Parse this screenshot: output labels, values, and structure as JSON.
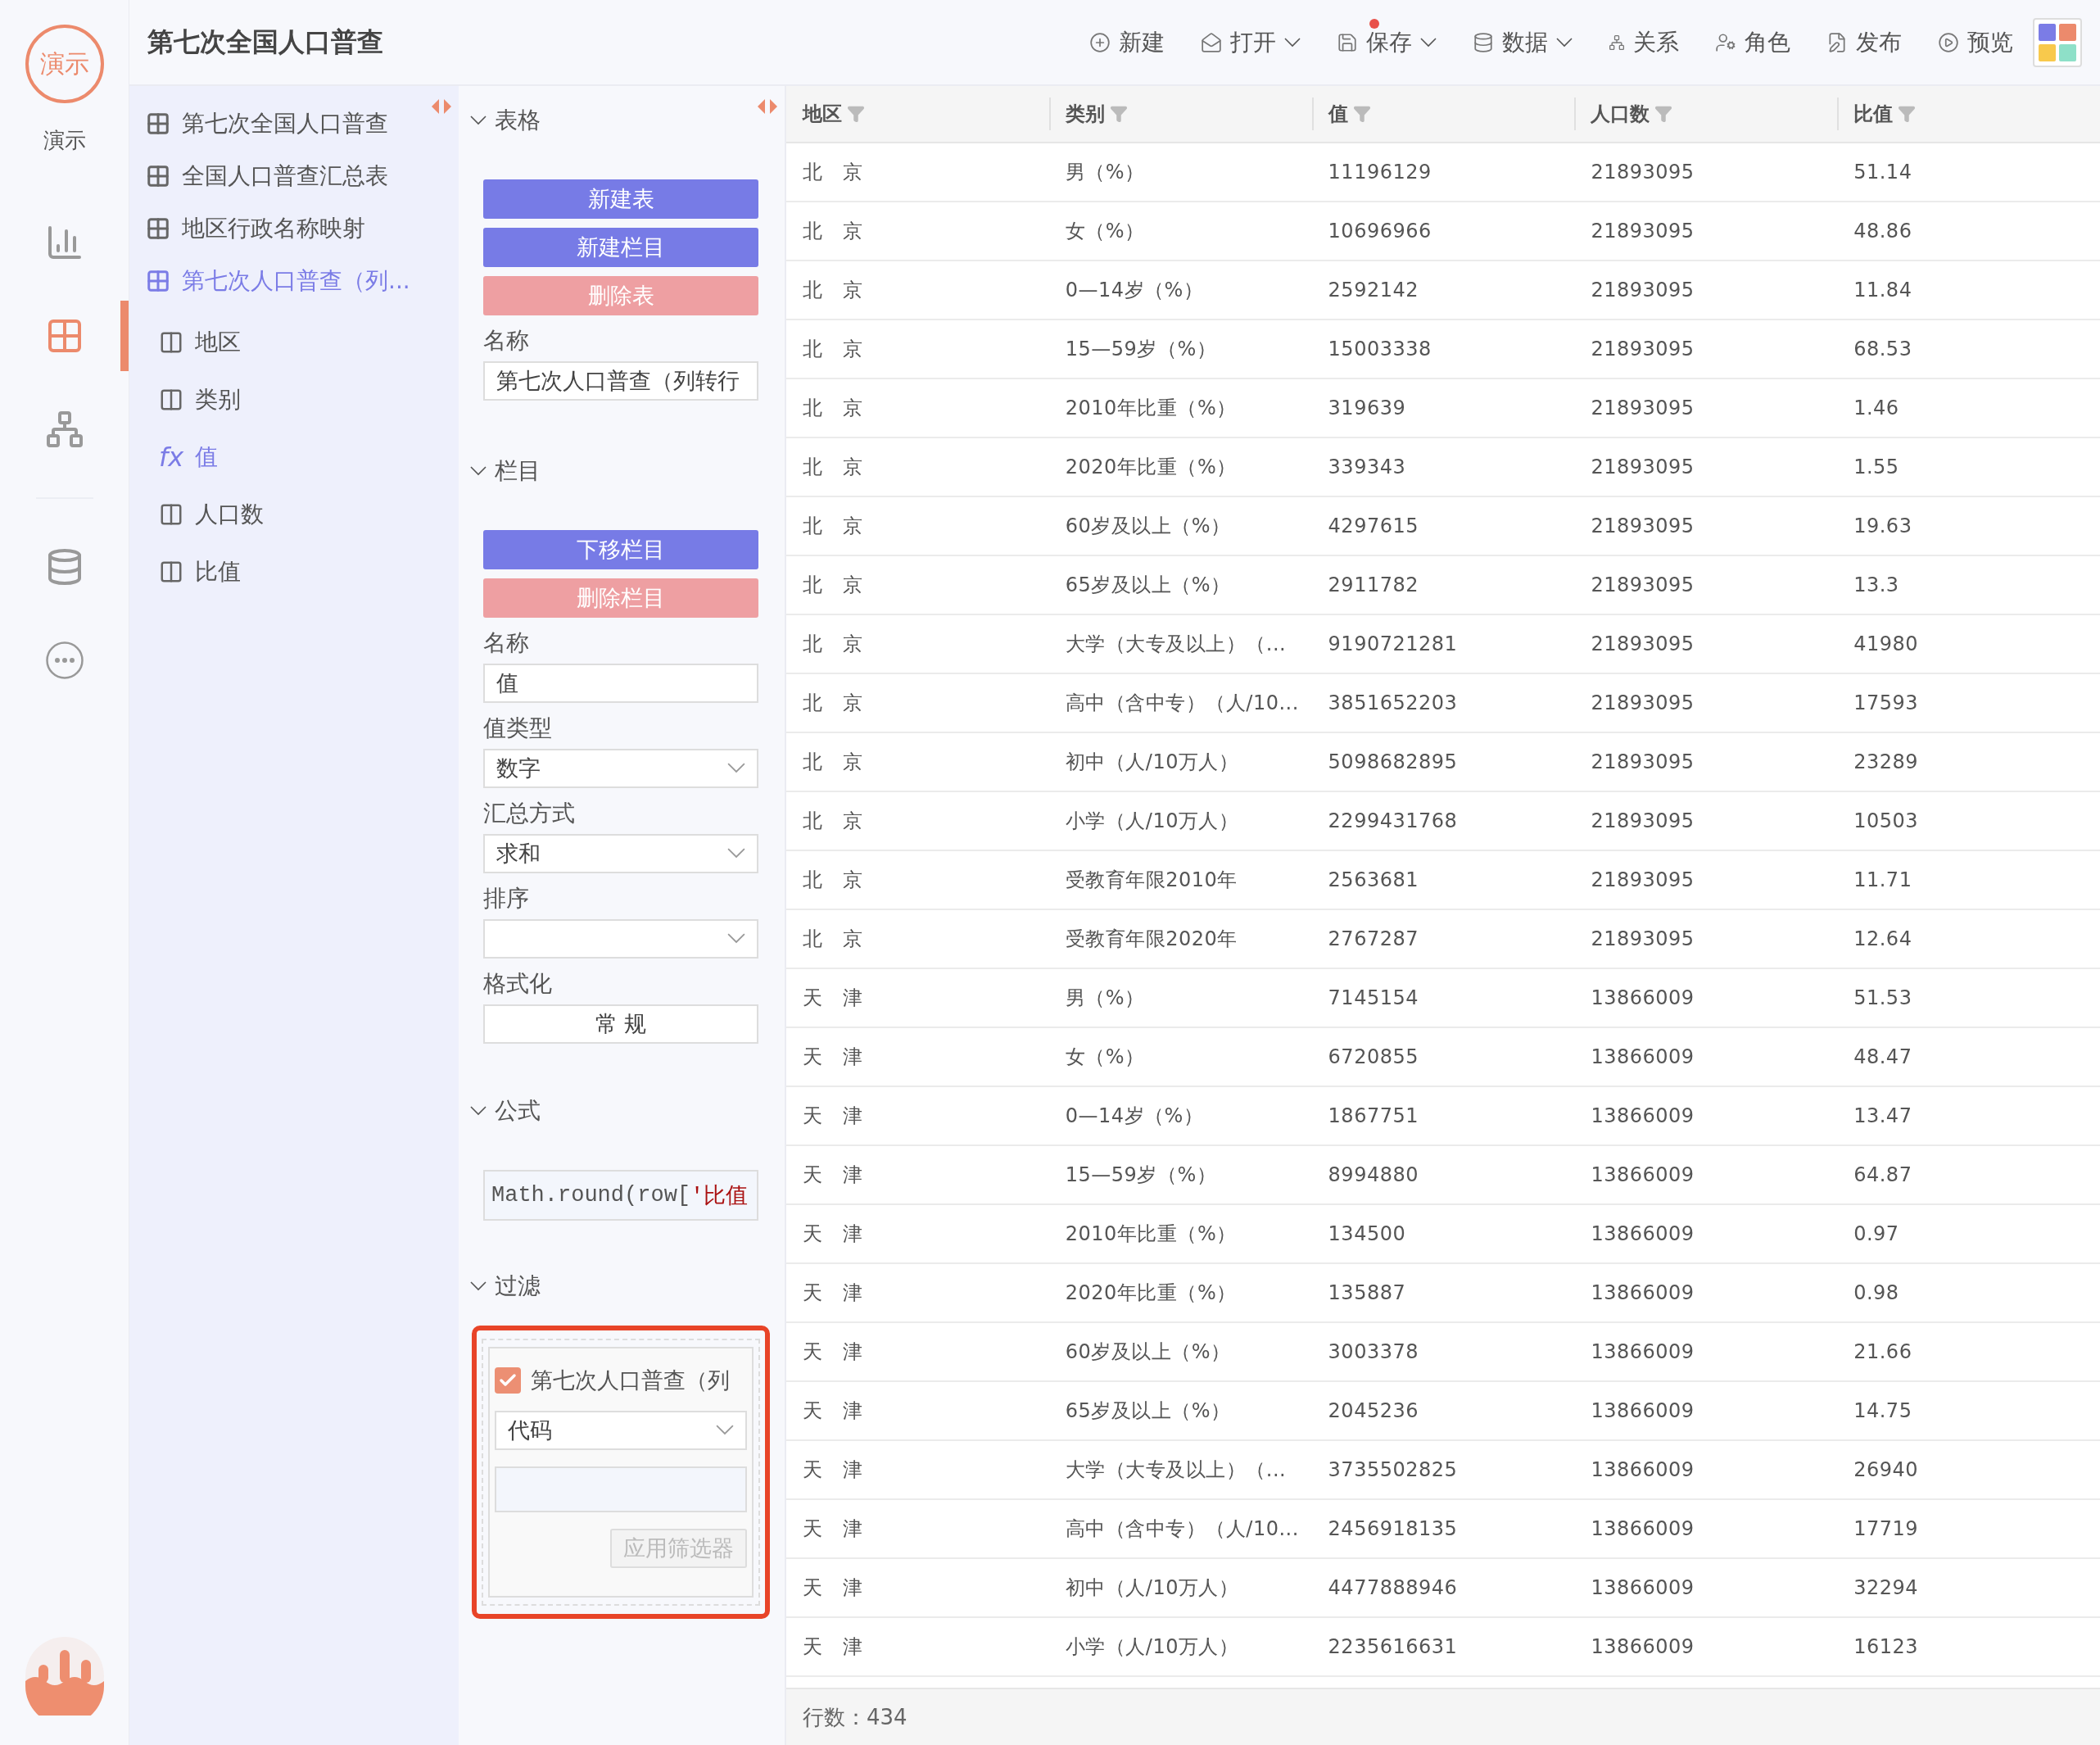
{
  "app": {
    "logo": "演示",
    "label": "演示"
  },
  "rail": [
    {
      "selected": false
    },
    {
      "selected": true
    },
    {
      "selected": false
    },
    {
      "selected": false
    },
    {
      "selected": false
    }
  ],
  "header": {
    "title": "第七次全国人口普查"
  },
  "toolbar": [
    {
      "label": "新建",
      "caret": false,
      "unsaved": false
    },
    {
      "label": "打开",
      "caret": true,
      "unsaved": false
    },
    {
      "label": "保存",
      "caret": true,
      "unsaved": true
    },
    {
      "label": "数据",
      "caret": true,
      "unsaved": false
    },
    {
      "label": "关系",
      "caret": false,
      "unsaved": false
    },
    {
      "label": "角色",
      "caret": false,
      "unsaved": false
    },
    {
      "label": "发布",
      "caret": false,
      "unsaved": false
    },
    {
      "label": "预览",
      "caret": false,
      "unsaved": false
    }
  ],
  "tree": [
    {
      "kind": "table",
      "label": "第七次全国人口普查",
      "selected": false
    },
    {
      "kind": "table",
      "label": "全国人口普查汇总表",
      "selected": false
    },
    {
      "kind": "table",
      "label": "地区行政名称映射",
      "selected": false
    },
    {
      "kind": "table",
      "label": "第七次人口普查（列...",
      "selected": true,
      "children": [
        {
          "kind": "column",
          "label": "地区"
        },
        {
          "kind": "column",
          "label": "类别"
        },
        {
          "kind": "formula",
          "symbol": "fx",
          "label": "值"
        },
        {
          "kind": "column",
          "label": "人口数"
        },
        {
          "kind": "column",
          "label": "比值"
        }
      ]
    }
  ],
  "props": {
    "table_section": {
      "title": "表格",
      "expanded": true,
      "buttons": [
        {
          "label": "新建表",
          "kind": "primary"
        },
        {
          "label": "新建栏目",
          "kind": "primary"
        },
        {
          "label": "删除表",
          "kind": "danger"
        }
      ],
      "name_label": "名称",
      "name_value": "第七次人口普查（列转行"
    },
    "column_section": {
      "title": "栏目",
      "expanded": true,
      "buttons": [
        {
          "label": "下移栏目",
          "kind": "primary"
        },
        {
          "label": "删除栏目",
          "kind": "danger"
        }
      ],
      "fields": [
        {
          "kind": "input",
          "label": "名称",
          "value": "值"
        },
        {
          "kind": "select",
          "label": "值类型",
          "value": "数字"
        },
        {
          "kind": "select",
          "label": "汇总方式",
          "value": "求和"
        },
        {
          "kind": "select",
          "label": "排序"
        },
        {
          "kind": "button",
          "label": "格式化",
          "value": "常 规"
        }
      ]
    },
    "formula_section": {
      "title": "公式",
      "expanded": true,
      "code": "Math.round(row[",
      "string": "'比值"
    },
    "filter_section": {
      "title": "过滤",
      "expanded": true,
      "highlighted": true,
      "checkbox": {
        "label": "第七次人口普查（列",
        "checked": true
      },
      "select": "代码",
      "apply": {
        "label": "应用筛选器",
        "disabled": true
      }
    }
  },
  "table": {
    "columns": [
      "地区",
      "类别",
      "值",
      "人口数",
      "比值"
    ],
    "rows": [
      [
        "北　京",
        "男（%）",
        "11196129",
        "21893095",
        "51.14"
      ],
      [
        "北　京",
        "女（%）",
        "10696966",
        "21893095",
        "48.86"
      ],
      [
        "北　京",
        "0—14岁（%）",
        "2592142",
        "21893095",
        "11.84"
      ],
      [
        "北　京",
        "15—59岁（%）",
        "15003338",
        "21893095",
        "68.53"
      ],
      [
        "北　京",
        "2010年比重（%）",
        "319639",
        "21893095",
        "1.46"
      ],
      [
        "北　京",
        "2020年比重（%）",
        "339343",
        "21893095",
        "1.55"
      ],
      [
        "北　京",
        "60岁及以上（%）",
        "4297615",
        "21893095",
        "19.63"
      ],
      [
        "北　京",
        "65岁及以上（%）",
        "2911782",
        "21893095",
        "13.3"
      ],
      [
        "北　京",
        "大学（大专及以上）（...",
        "9190721281",
        "21893095",
        "41980"
      ],
      [
        "北　京",
        "高中（含中专）（人/10...",
        "3851652203",
        "21893095",
        "17593"
      ],
      [
        "北　京",
        "初中（人/10万人）",
        "5098682895",
        "21893095",
        "23289"
      ],
      [
        "北　京",
        "小学（人/10万人）",
        "2299431768",
        "21893095",
        "10503"
      ],
      [
        "北　京",
        "受教育年限2010年",
        "2563681",
        "21893095",
        "11.71"
      ],
      [
        "北　京",
        "受教育年限2020年",
        "2767287",
        "21893095",
        "12.64"
      ],
      [
        "天　津",
        "男（%）",
        "7145154",
        "13866009",
        "51.53"
      ],
      [
        "天　津",
        "女（%）",
        "6720855",
        "13866009",
        "48.47"
      ],
      [
        "天　津",
        "0—14岁（%）",
        "1867751",
        "13866009",
        "13.47"
      ],
      [
        "天　津",
        "15—59岁（%）",
        "8994880",
        "13866009",
        "64.87"
      ],
      [
        "天　津",
        "2010年比重（%）",
        "134500",
        "13866009",
        "0.97"
      ],
      [
        "天　津",
        "2020年比重（%）",
        "135887",
        "13866009",
        "0.98"
      ],
      [
        "天　津",
        "60岁及以上（%）",
        "3003378",
        "13866009",
        "21.66"
      ],
      [
        "天　津",
        "65岁及以上（%）",
        "2045236",
        "13866009",
        "14.75"
      ],
      [
        "天　津",
        "大学（大专及以上）（...",
        "3735502825",
        "13866009",
        "26940"
      ],
      [
        "天　津",
        "高中（含中专）（人/10...",
        "2456918135",
        "13866009",
        "17719"
      ],
      [
        "天　津",
        "初中（人/10万人）",
        "4477888946",
        "13866009",
        "32294"
      ],
      [
        "天　津",
        "小学（人/10万人）",
        "2235616631",
        "13866009",
        "16123"
      ]
    ],
    "status": "行数：434"
  }
}
